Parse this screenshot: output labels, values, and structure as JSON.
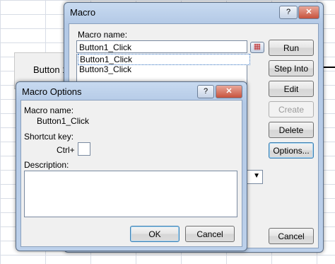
{
  "sheet": {
    "button_label": "Button 1"
  },
  "macro": {
    "title": "Macro",
    "help_glyph": "?",
    "close_glyph": "✕",
    "macro_name_label": "Macro name:",
    "macro_name_value": "Button1_Click",
    "list_items": [
      "Button1_Click",
      "Button3_Click"
    ],
    "buttons": {
      "run": "Run",
      "step_into": "Step Into",
      "edit": "Edit",
      "create": "Create",
      "delete": "Delete",
      "options": "Options...",
      "cancel": "Cancel"
    }
  },
  "options": {
    "title": "Macro Options",
    "help_glyph": "?",
    "close_glyph": "✕",
    "macro_name_label": "Macro name:",
    "macro_name_value": "Button1_Click",
    "shortcut_label": "Shortcut key:",
    "ctrl_label": "Ctrl+",
    "shortcut_value": "",
    "description_label": "Description:",
    "description_value": "",
    "ok_label": "OK",
    "cancel_label": "Cancel"
  }
}
